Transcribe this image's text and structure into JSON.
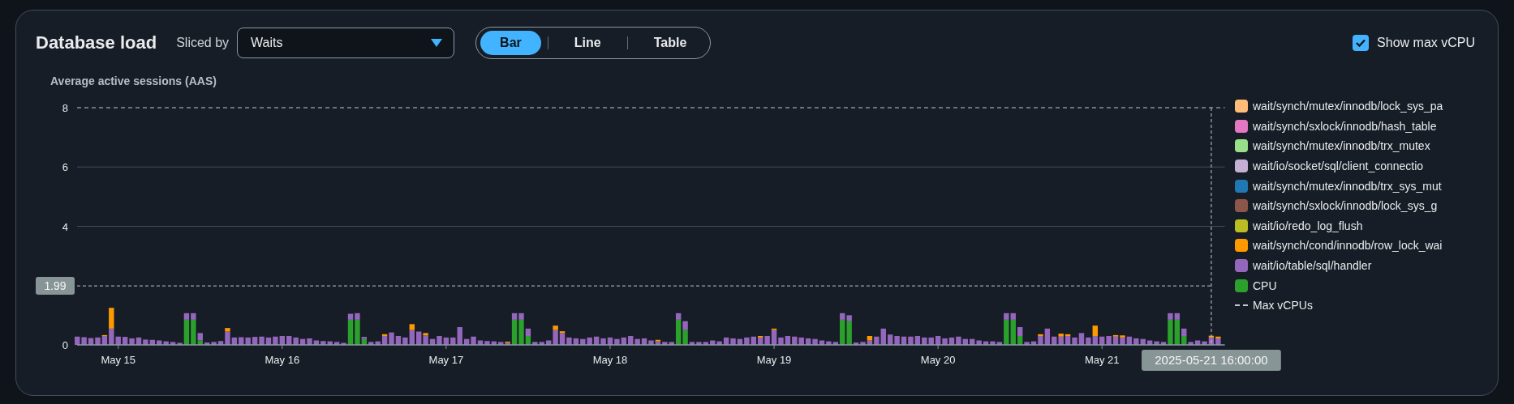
{
  "panel": {
    "title": "Database load",
    "slice_label": "Sliced by",
    "slice_select": {
      "value": "Waits"
    },
    "view_tabs": [
      {
        "label": "Bar",
        "selected": true
      },
      {
        "label": "Line",
        "selected": false
      },
      {
        "label": "Table",
        "selected": false
      }
    ],
    "show_max_vcpu": {
      "label": "Show max vCPU",
      "checked": true
    },
    "chart": {
      "max_line": {
        "label": "Max vCPUs"
      },
      "chart_data": {
        "type": "bar",
        "stacked": true,
        "ylabel": "Average active sessions (AAS)",
        "ylim": [
          0,
          8
        ],
        "yticks": [
          0,
          4,
          6,
          8
        ],
        "categories": [
          null,
          null,
          null,
          null,
          null,
          null,
          "May 15",
          null,
          null,
          null,
          null,
          null,
          null,
          null,
          null,
          null,
          null,
          null,
          null,
          null,
          null,
          null,
          null,
          null,
          null,
          null,
          null,
          null,
          null,
          null,
          "May 16",
          null,
          null,
          null,
          null,
          null,
          null,
          null,
          null,
          null,
          null,
          null,
          null,
          null,
          null,
          null,
          null,
          null,
          null,
          null,
          null,
          null,
          null,
          null,
          "May 17",
          null,
          null,
          null,
          null,
          null,
          null,
          null,
          null,
          null,
          null,
          null,
          null,
          null,
          null,
          null,
          null,
          null,
          null,
          null,
          null,
          null,
          null,
          null,
          "May 18",
          null,
          null,
          null,
          null,
          null,
          null,
          null,
          null,
          null,
          null,
          null,
          null,
          null,
          null,
          null,
          null,
          null,
          null,
          null,
          null,
          null,
          null,
          null,
          "May 19",
          null,
          null,
          null,
          null,
          null,
          null,
          null,
          null,
          null,
          null,
          null,
          null,
          null,
          null,
          null,
          null,
          null,
          null,
          null,
          null,
          null,
          null,
          null,
          "May 20",
          null,
          null,
          null,
          null,
          null,
          null,
          null,
          null,
          null,
          null,
          null,
          null,
          null,
          null,
          null,
          null,
          null,
          null,
          null,
          null,
          null,
          null,
          null,
          "May 21",
          null,
          null,
          null,
          null,
          null,
          null,
          null,
          null,
          null,
          null,
          null,
          null,
          null,
          null,
          null,
          null,
          null
        ],
        "series": [
          {
            "name": "CPU",
            "color": "#2ca02c",
            "values": [
              0,
              0,
              0,
              0,
              0,
              0,
              0,
              0,
              0,
              0,
              0,
              0,
              0,
              0,
              0,
              0,
              0.85,
              0.85,
              0.15,
              0,
              0,
              0,
              0,
              0,
              0,
              0,
              0,
              0,
              0,
              0,
              0,
              0,
              0,
              0,
              0,
              0,
              0,
              0,
              0,
              0,
              0.85,
              0.85,
              0.2,
              0,
              0,
              0,
              0,
              0,
              0,
              0,
              0,
              0,
              0,
              0,
              0,
              0,
              0,
              0,
              0,
              0,
              0,
              0,
              0,
              0,
              0.85,
              0.85,
              0.3,
              0,
              0,
              0,
              0,
              0,
              0,
              0,
              0,
              0,
              0,
              0,
              0,
              0,
              0,
              0,
              0,
              0,
              0,
              0,
              0,
              0,
              0.85,
              0.5,
              0,
              0,
              0,
              0,
              0,
              0,
              0,
              0,
              0,
              0,
              0,
              0,
              0,
              0,
              0,
              0,
              0,
              0,
              0,
              0,
              0,
              0,
              0.85,
              0.8,
              0,
              0,
              0,
              0,
              0,
              0,
              0,
              0,
              0,
              0,
              0,
              0,
              0,
              0,
              0,
              0,
              0,
              0,
              0,
              0,
              0,
              0,
              0.85,
              0.85,
              0.3,
              0,
              0,
              0,
              0,
              0,
              0,
              0,
              0,
              0,
              0,
              0,
              0,
              0,
              0,
              0,
              0,
              0,
              0,
              0,
              0,
              0,
              0.85,
              0.85,
              0.3,
              0,
              0,
              0,
              0,
              0
            ]
          },
          {
            "name": "wait/io/table/sql/handler",
            "color": "#9467bd",
            "values": [
              0.28,
              0.26,
              0.23,
              0.25,
              0.3,
              0.55,
              0.28,
              0.27,
              0.22,
              0.25,
              0.18,
              0.17,
              0.15,
              0.12,
              0.1,
              0.07,
              0.22,
              0.22,
              0.25,
              0.08,
              0.1,
              0.13,
              0.45,
              0.25,
              0.26,
              0.25,
              0.27,
              0.28,
              0.25,
              0.28,
              0.3,
              0.3,
              0.25,
              0.2,
              0.22,
              0.15,
              0.13,
              0.12,
              0.1,
              0.07,
              0.2,
              0.22,
              0.07,
              0.1,
              0.12,
              0.3,
              0.42,
              0.3,
              0.25,
              0.5,
              0.45,
              0.32,
              0.2,
              0.3,
              0.25,
              0.25,
              0.6,
              0.2,
              0.28,
              0.15,
              0.13,
              0.12,
              0.1,
              0.07,
              0.22,
              0.22,
              0.25,
              0.1,
              0.1,
              0.15,
              0.5,
              0.4,
              0.25,
              0.22,
              0.2,
              0.25,
              0.28,
              0.22,
              0.25,
              0.2,
              0.25,
              0.3,
              0.2,
              0.22,
              0.15,
              0.12,
              0.1,
              0.1,
              0.22,
              0.3,
              0.1,
              0.1,
              0.1,
              0.15,
              0.12,
              0.25,
              0.22,
              0.2,
              0.25,
              0.28,
              0.25,
              0.3,
              0.5,
              0.25,
              0.3,
              0.28,
              0.25,
              0.22,
              0.2,
              0.15,
              0.12,
              0.1,
              0.22,
              0.2,
              0.08,
              0.1,
              0.15,
              0.28,
              0.55,
              0.35,
              0.3,
              0.28,
              0.28,
              0.3,
              0.25,
              0.25,
              0.3,
              0.22,
              0.25,
              0.28,
              0.2,
              0.2,
              0.15,
              0.12,
              0.12,
              0.1,
              0.22,
              0.22,
              0.3,
              0.1,
              0.12,
              0.3,
              0.55,
              0.28,
              0.28,
              0.3,
              0.25,
              0.4,
              0.25,
              0.3,
              0.28,
              0.3,
              0.28,
              0.25,
              0.28,
              0.22,
              0.2,
              0.15,
              0.12,
              0.1,
              0.22,
              0.22,
              0.25,
              0.1,
              0.15,
              0.12,
              0.25,
              0.22
            ]
          },
          {
            "name": "wait/synch/cond/innodb/row_lock_wai",
            "color": "#ff9900",
            "values": [
              0,
              0,
              0,
              0,
              0.03,
              0.7,
              0,
              0,
              0,
              0,
              0,
              0,
              0,
              0,
              0,
              0,
              0,
              0,
              0,
              0,
              0,
              0,
              0.12,
              0,
              0,
              0,
              0,
              0,
              0,
              0,
              0,
              0,
              0,
              0,
              0,
              0,
              0,
              0,
              0,
              0,
              0,
              0,
              0,
              0,
              0,
              0.06,
              0,
              0,
              0,
              0.2,
              0,
              0.08,
              0,
              0,
              0,
              0,
              0,
              0,
              0,
              0,
              0,
              0,
              0,
              0.04,
              0,
              0,
              0,
              0,
              0,
              0,
              0.15,
              0.06,
              0,
              0,
              0,
              0,
              0,
              0,
              0,
              0,
              0,
              0,
              0,
              0,
              0,
              0.05,
              0,
              0,
              0,
              0,
              0,
              0,
              0,
              0,
              0,
              0,
              0,
              0,
              0,
              0,
              0.05,
              0,
              0.05,
              0,
              0,
              0,
              0,
              0,
              0,
              0,
              0,
              0,
              0,
              0,
              0,
              0,
              0.15,
              0,
              0,
              0,
              0,
              0,
              0,
              0,
              0,
              0,
              0,
              0,
              0,
              0,
              0,
              0,
              0,
              0,
              0,
              0,
              0,
              0,
              0,
              0,
              0,
              0.06,
              0,
              0,
              0.1,
              0.06,
              0,
              0,
              0,
              0.35,
              0,
              0,
              0.05,
              0.07,
              0,
              0,
              0,
              0,
              0,
              0,
              0,
              0,
              0,
              0,
              0,
              0,
              0.06,
              0.06
            ]
          },
          {
            "name": "wait/io/redo_log_flush",
            "color": "#bcbd22",
            "values": [
              0,
              0,
              0,
              0,
              0,
              0,
              0,
              0,
              0,
              0,
              0,
              0,
              0,
              0,
              0,
              0,
              0,
              0,
              0,
              0,
              0,
              0,
              0,
              0,
              0,
              0,
              0,
              0,
              0,
              0,
              0,
              0,
              0,
              0,
              0,
              0,
              0,
              0,
              0,
              0,
              0,
              0,
              0,
              0,
              0,
              0,
              0,
              0,
              0,
              0,
              0,
              0,
              0,
              0,
              0,
              0,
              0,
              0,
              0,
              0,
              0,
              0,
              0,
              0,
              0,
              0,
              0,
              0,
              0,
              0,
              0,
              0,
              0,
              0,
              0,
              0,
              0,
              0,
              0,
              0,
              0,
              0,
              0,
              0,
              0,
              0,
              0,
              0,
              0,
              0,
              0,
              0,
              0,
              0,
              0,
              0,
              0,
              0,
              0,
              0,
              0,
              0,
              0,
              0,
              0,
              0,
              0,
              0,
              0,
              0,
              0,
              0,
              0,
              0,
              0,
              0,
              0,
              0,
              0,
              0,
              0,
              0,
              0,
              0,
              0,
              0,
              0,
              0,
              0,
              0,
              0,
              0,
              0,
              0,
              0,
              0,
              0,
              0,
              0,
              0,
              0,
              0,
              0,
              0,
              0,
              0,
              0,
              0,
              0,
              0,
              0,
              0,
              0,
              0,
              0,
              0,
              0,
              0,
              0,
              0,
              0,
              0,
              0,
              0,
              0,
              0,
              0,
              0
            ]
          },
          {
            "name": "wait/synch/sxlock/innodb/lock_sys_g",
            "color": "#8c564b",
            "values": [
              0,
              0,
              0,
              0,
              0,
              0,
              0,
              0,
              0,
              0,
              0,
              0,
              0,
              0,
              0,
              0,
              0,
              0,
              0,
              0,
              0,
              0,
              0,
              0,
              0,
              0,
              0,
              0,
              0,
              0,
              0,
              0,
              0,
              0,
              0,
              0,
              0,
              0,
              0,
              0,
              0,
              0,
              0,
              0,
              0,
              0,
              0,
              0,
              0,
              0,
              0,
              0,
              0,
              0,
              0,
              0,
              0,
              0,
              0,
              0,
              0,
              0,
              0,
              0,
              0,
              0,
              0,
              0,
              0,
              0,
              0,
              0,
              0,
              0,
              0,
              0,
              0,
              0,
              0,
              0,
              0,
              0,
              0,
              0,
              0,
              0,
              0,
              0,
              0,
              0,
              0,
              0,
              0,
              0,
              0,
              0,
              0,
              0,
              0,
              0,
              0,
              0,
              0,
              0,
              0,
              0,
              0,
              0,
              0,
              0,
              0,
              0,
              0,
              0,
              0,
              0,
              0,
              0,
              0,
              0,
              0,
              0,
              0,
              0,
              0,
              0,
              0,
              0,
              0,
              0,
              0,
              0,
              0,
              0,
              0,
              0,
              0,
              0,
              0,
              0,
              0,
              0,
              0,
              0,
              0,
              0,
              0,
              0,
              0,
              0,
              0,
              0,
              0,
              0,
              0,
              0,
              0,
              0,
              0,
              0,
              0,
              0,
              0,
              0,
              0,
              0,
              0,
              0
            ]
          },
          {
            "name": "wait/synch/mutex/innodb/trx_sys_mut",
            "color": "#1f77b4",
            "values": [
              0,
              0,
              0,
              0,
              0,
              0,
              0,
              0,
              0,
              0,
              0,
              0,
              0,
              0,
              0,
              0,
              0,
              0,
              0,
              0,
              0,
              0,
              0,
              0,
              0,
              0,
              0,
              0,
              0,
              0,
              0,
              0,
              0,
              0,
              0,
              0,
              0,
              0,
              0,
              0,
              0,
              0,
              0,
              0,
              0,
              0,
              0,
              0,
              0,
              0,
              0,
              0,
              0,
              0,
              0,
              0,
              0,
              0,
              0,
              0,
              0,
              0,
              0,
              0,
              0,
              0,
              0,
              0,
              0,
              0,
              0,
              0,
              0,
              0,
              0,
              0,
              0,
              0,
              0,
              0,
              0,
              0,
              0,
              0,
              0,
              0,
              0,
              0,
              0,
              0,
              0,
              0,
              0,
              0,
              0,
              0,
              0,
              0,
              0,
              0,
              0,
              0,
              0,
              0,
              0,
              0,
              0,
              0,
              0,
              0,
              0,
              0,
              0,
              0,
              0,
              0,
              0,
              0,
              0,
              0,
              0,
              0,
              0,
              0,
              0,
              0,
              0,
              0,
              0,
              0,
              0,
              0,
              0,
              0,
              0,
              0,
              0,
              0,
              0,
              0,
              0,
              0,
              0,
              0,
              0,
              0,
              0,
              0,
              0,
              0,
              0,
              0,
              0,
              0,
              0,
              0,
              0,
              0,
              0,
              0,
              0,
              0,
              0,
              0,
              0,
              0,
              0,
              0
            ]
          },
          {
            "name": "wait/io/socket/sql/client_connectio",
            "color": "#c5b0d5",
            "values": [
              0,
              0,
              0,
              0,
              0,
              0,
              0,
              0,
              0,
              0,
              0,
              0,
              0,
              0,
              0,
              0,
              0,
              0,
              0,
              0,
              0,
              0,
              0,
              0,
              0,
              0,
              0,
              0,
              0,
              0,
              0,
              0,
              0,
              0,
              0,
              0,
              0,
              0,
              0,
              0,
              0,
              0,
              0,
              0,
              0,
              0,
              0,
              0,
              0,
              0,
              0,
              0,
              0,
              0,
              0,
              0,
              0,
              0,
              0,
              0,
              0,
              0,
              0,
              0,
              0,
              0,
              0,
              0,
              0,
              0,
              0,
              0,
              0,
              0,
              0,
              0,
              0,
              0,
              0,
              0,
              0,
              0,
              0,
              0,
              0,
              0,
              0,
              0,
              0,
              0,
              0,
              0,
              0,
              0,
              0,
              0,
              0,
              0,
              0,
              0,
              0,
              0,
              0,
              0,
              0,
              0,
              0,
              0,
              0,
              0,
              0,
              0,
              0,
              0,
              0,
              0,
              0,
              0,
              0,
              0,
              0,
              0,
              0,
              0,
              0,
              0,
              0,
              0,
              0,
              0,
              0,
              0,
              0,
              0,
              0,
              0,
              0,
              0,
              0,
              0,
              0,
              0,
              0,
              0,
              0,
              0,
              0,
              0,
              0,
              0,
              0,
              0,
              0,
              0,
              0,
              0,
              0,
              0,
              0,
              0,
              0,
              0,
              0,
              0,
              0,
              0,
              0,
              0
            ]
          },
          {
            "name": "wait/synch/mutex/innodb/trx_mutex",
            "color": "#98df8a",
            "values": [
              0,
              0,
              0,
              0,
              0,
              0,
              0,
              0,
              0,
              0,
              0,
              0,
              0,
              0,
              0,
              0,
              0,
              0,
              0,
              0,
              0,
              0,
              0,
              0,
              0,
              0,
              0,
              0,
              0,
              0,
              0,
              0,
              0,
              0,
              0,
              0,
              0,
              0,
              0,
              0,
              0,
              0,
              0,
              0,
              0,
              0,
              0,
              0,
              0,
              0,
              0,
              0,
              0,
              0,
              0,
              0,
              0,
              0,
              0,
              0,
              0,
              0,
              0,
              0,
              0,
              0,
              0,
              0,
              0,
              0,
              0,
              0,
              0,
              0,
              0,
              0,
              0,
              0,
              0,
              0,
              0,
              0,
              0,
              0,
              0,
              0,
              0,
              0,
              0,
              0,
              0,
              0,
              0,
              0,
              0,
              0,
              0,
              0,
              0,
              0,
              0,
              0,
              0,
              0,
              0,
              0,
              0,
              0,
              0,
              0,
              0,
              0,
              0,
              0,
              0,
              0,
              0,
              0,
              0,
              0,
              0,
              0,
              0,
              0,
              0,
              0,
              0,
              0,
              0,
              0,
              0,
              0,
              0,
              0,
              0,
              0,
              0,
              0,
              0,
              0,
              0,
              0,
              0,
              0,
              0,
              0,
              0,
              0,
              0,
              0,
              0,
              0,
              0,
              0,
              0,
              0,
              0,
              0,
              0,
              0,
              0,
              0,
              0,
              0,
              0,
              0,
              0,
              0
            ]
          },
          {
            "name": "wait/synch/sxlock/innodb/hash_table",
            "color": "#e377c2",
            "values": [
              0,
              0,
              0,
              0,
              0,
              0,
              0,
              0,
              0,
              0,
              0,
              0,
              0,
              0,
              0,
              0,
              0,
              0,
              0,
              0,
              0,
              0,
              0,
              0,
              0,
              0,
              0,
              0,
              0,
              0,
              0,
              0,
              0,
              0,
              0,
              0,
              0,
              0,
              0,
              0,
              0,
              0,
              0,
              0,
              0,
              0,
              0,
              0,
              0,
              0,
              0,
              0,
              0,
              0,
              0,
              0,
              0,
              0,
              0,
              0,
              0,
              0,
              0,
              0,
              0,
              0,
              0,
              0,
              0,
              0,
              0,
              0,
              0,
              0,
              0,
              0,
              0,
              0,
              0,
              0,
              0,
              0,
              0,
              0,
              0,
              0,
              0,
              0,
              0,
              0,
              0,
              0,
              0,
              0,
              0,
              0,
              0,
              0,
              0,
              0,
              0,
              0,
              0,
              0,
              0,
              0,
              0,
              0,
              0,
              0,
              0,
              0,
              0,
              0,
              0,
              0,
              0,
              0,
              0,
              0,
              0,
              0,
              0,
              0,
              0,
              0,
              0,
              0,
              0,
              0,
              0,
              0,
              0,
              0,
              0,
              0,
              0,
              0,
              0,
              0,
              0,
              0,
              0,
              0,
              0,
              0,
              0,
              0,
              0,
              0,
              0,
              0,
              0,
              0,
              0,
              0,
              0,
              0,
              0,
              0,
              0,
              0,
              0,
              0,
              0,
              0,
              0,
              0
            ]
          },
          {
            "name": "wait/synch/mutex/innodb/lock_sys_pa",
            "color": "#ffbb78",
            "values": [
              0,
              0,
              0,
              0,
              0,
              0,
              0,
              0,
              0,
              0,
              0,
              0,
              0,
              0,
              0,
              0,
              0,
              0,
              0,
              0,
              0,
              0,
              0,
              0,
              0,
              0,
              0,
              0,
              0,
              0,
              0,
              0,
              0,
              0,
              0,
              0,
              0,
              0,
              0,
              0,
              0,
              0,
              0,
              0,
              0,
              0,
              0,
              0,
              0,
              0,
              0,
              0,
              0,
              0,
              0,
              0,
              0,
              0,
              0,
              0,
              0,
              0,
              0,
              0,
              0,
              0,
              0,
              0,
              0,
              0,
              0,
              0,
              0,
              0,
              0,
              0,
              0,
              0,
              0,
              0,
              0,
              0,
              0,
              0,
              0,
              0,
              0,
              0,
              0,
              0,
              0,
              0,
              0,
              0,
              0,
              0,
              0,
              0,
              0,
              0,
              0,
              0,
              0,
              0,
              0,
              0,
              0,
              0,
              0,
              0,
              0,
              0,
              0,
              0,
              0,
              0,
              0,
              0,
              0,
              0,
              0,
              0,
              0,
              0,
              0,
              0,
              0,
              0,
              0,
              0,
              0,
              0,
              0,
              0,
              0,
              0,
              0,
              0,
              0,
              0,
              0,
              0,
              0,
              0,
              0,
              0,
              0,
              0,
              0,
              0,
              0,
              0,
              0,
              0,
              0,
              0,
              0,
              0,
              0,
              0,
              0,
              0,
              0,
              0,
              0,
              0,
              0,
              0
            ]
          }
        ]
      },
      "hover": {
        "y_label": "1.99",
        "x_label": "2025-05-21 16:00:00"
      }
    }
  }
}
